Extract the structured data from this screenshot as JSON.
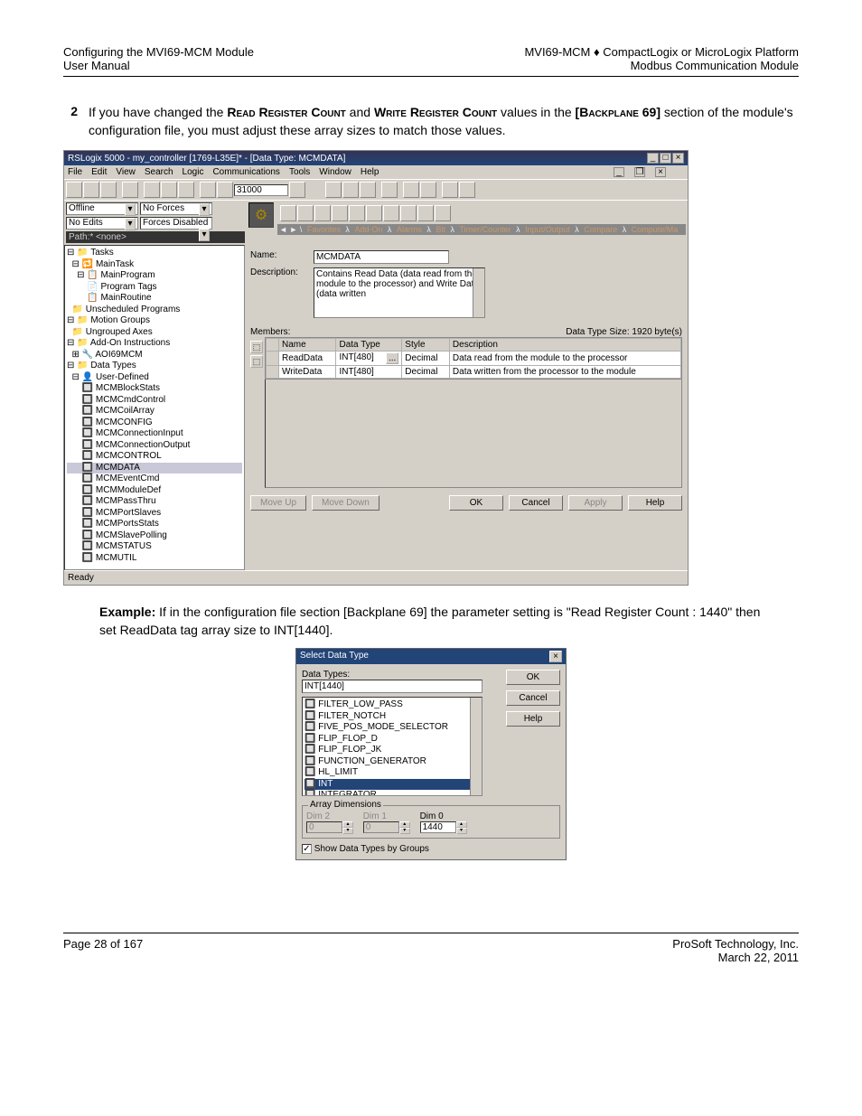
{
  "header": {
    "left_line1": "Configuring the MVI69-MCM Module",
    "left_line2": "User Manual",
    "right_line1": "MVI69-MCM ♦ CompactLogix or MicroLogix Platform",
    "right_line2": "Modbus Communication Module"
  },
  "step": {
    "number": "2",
    "text_lead": "If you have changed the ",
    "rrc": "Read Register Count",
    "text_mid1": " and ",
    "wrc": "Write Register Count",
    "text_mid2": " values in the ",
    "backplane": "[Backplane 69]",
    "text_tail": " section of the module's configuration file, you must adjust these array sizes to match those values."
  },
  "rslogix": {
    "title": "RSLogix 5000 - my_controller [1769-L35E]* - [Data Type: MCMDATA]",
    "menus": [
      "File",
      "Edit",
      "View",
      "Search",
      "Logic",
      "Communications",
      "Tools",
      "Window",
      "Help"
    ],
    "path_value": "31000",
    "offline": "Offline",
    "noforces": "No Forces",
    "noedits": "No Edits",
    "forcesdisabled": "Forces Disabled",
    "path_label": "Path:* <none>",
    "tabs": [
      "Favorites",
      "Add-On",
      "Alarms",
      "Bit",
      "Timer/Counter",
      "Input/Output",
      "Compare",
      "Compute/Ma"
    ],
    "tree": {
      "items": [
        "⊟ 📁 Tasks",
        "  ⊟ 🔁 MainTask",
        "    ⊟ 📋 MainProgram",
        "        📄 Program Tags",
        "        📋 MainRoutine",
        "  📁 Unscheduled Programs",
        "⊟ 📁 Motion Groups",
        "  📁 Ungrouped Axes",
        "⊟ 📁 Add-On Instructions",
        "  ⊞ 🔧 AOI69MCM",
        "⊟ 📁 Data Types",
        "  ⊟ 👤 User-Defined",
        "      🔲 MCMBlockStats",
        "      🔲 MCMCmdControl",
        "      🔲 MCMCoilArray",
        "      🔲 MCMCONFIG",
        "      🔲 MCMConnectionInput",
        "      🔲 MCMConnectionOutput",
        "      🔲 MCMCONTROL",
        "      🔲 MCMDATA",
        "      🔲 MCMEventCmd",
        "      🔲 MCMModuleDef",
        "      🔲 MCMPassThru",
        "      🔲 MCMPortSlaves",
        "      🔲 MCMPortsStats",
        "      🔲 MCMSlavePolling",
        "      🔲 MCMSTATUS",
        "      🔲 MCMUTIL"
      ],
      "selected": "      🔲 MCMDATA"
    },
    "detail": {
      "name_label": "Name:",
      "name_value": "MCMDATA",
      "desc_label": "Description:",
      "desc_value": "Contains Read Data (data read from the module to the processor) and Write Data (data written",
      "members_label": "Members:",
      "size_label": "Data Type Size: 1920 byte(s)",
      "cols": [
        "Name",
        "Data Type",
        "Style",
        "Description"
      ],
      "rows": [
        {
          "name": "ReadData",
          "type": "INT[480]",
          "style": "Decimal",
          "desc": "Data read from the module to the processor"
        },
        {
          "name": "WriteData",
          "type": "INT[480]",
          "style": "Decimal",
          "desc": "Data written from the processor to the module"
        }
      ],
      "moveup": "Move Up",
      "movedown": "Move Down",
      "ok": "OK",
      "cancel": "Cancel",
      "apply": "Apply",
      "help": "Help"
    },
    "status": "Ready"
  },
  "example": {
    "label": "Example:",
    "text": " If in the configuration file section [Backplane 69] the parameter setting is \"Read Register Count : 1440\" then set ReadData tag array size to INT[1440]."
  },
  "dialog": {
    "title": "Select Data Type",
    "datatypes_label": "Data Types:",
    "datatypes_value": "INT[1440]",
    "ok": "OK",
    "cancel": "Cancel",
    "help": "Help",
    "list": [
      "FILTER_LOW_PASS",
      "FILTER_NOTCH",
      "FIVE_POS_MODE_SELECTOR",
      "FLIP_FLOP_D",
      "FLIP_FLOP_JK",
      "FUNCTION_GENERATOR",
      "HL_LIMIT",
      "INT",
      "INTEGRATOR"
    ],
    "list_selected": "INT",
    "dims_legend": "Array Dimensions",
    "dim2": "Dim 2",
    "dim1": "Dim 1",
    "dim0": "Dim 0",
    "dim2_val": "0",
    "dim1_val": "0",
    "dim0_val": "1440",
    "show_groups": "Show Data Types by Groups"
  },
  "footer": {
    "left": "Page 28 of 167",
    "right_line1": "ProSoft Technology, Inc.",
    "right_line2": "March 22, 2011"
  }
}
